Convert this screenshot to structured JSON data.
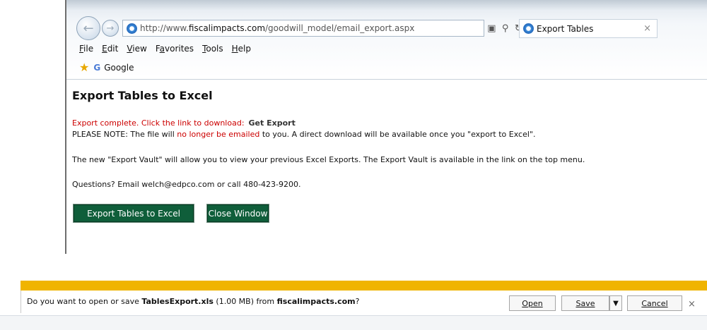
{
  "browser": {
    "address": {
      "prefix": "http://www.",
      "domain": "fiscalimpacts.com",
      "path": "/goodwill_model/email_export.aspx"
    },
    "tab_title": "Export Tables",
    "tab_close": "×",
    "menu": {
      "file": "ile",
      "file_key": "F",
      "edit": "dit",
      "edit_key": "E",
      "view": "iew",
      "view_key": "V",
      "favorites_pre": "F",
      "favorites_key": "a",
      "favorites_post": "vorites",
      "tools": "ools",
      "tools_key": "T",
      "help": "elp",
      "help_key": "H"
    },
    "favorite": "Google",
    "favorite_g": "G"
  },
  "page": {
    "title": "Export Tables to Excel",
    "export_msg": "Export complete. Click the link to download:",
    "export_link": "Get Export",
    "note_pre": "PLEASE NOTE: The file will",
    "note_red": "no longer be emailed",
    "note_post": "to you. A direct download will be available once you \"export to Excel\".",
    "vault_line": "The new \"Export Vault\" will allow you to view your previous Excel Exports. The Export Vault is available in the link on the top menu.",
    "questions": "Questions?  Email welch@edpco.com or call 480-423-9200.",
    "btn_export": "Export Tables to Excel",
    "btn_close": "Close Window"
  },
  "download": {
    "msg_pre": "Do you want to open or save",
    "file_name": "TablesExport.xls",
    "file_size": "(1.00 MB) from",
    "source": "fiscalimpacts.com",
    "msg_end": "?",
    "open": "Open",
    "save": "Save",
    "dropdown": "▼",
    "cancel": "Cancel",
    "close": "×"
  },
  "colors": {
    "accent_red": "#cc0000",
    "button_green": "#0f5e3a",
    "notification_bar": "#f0b400"
  }
}
